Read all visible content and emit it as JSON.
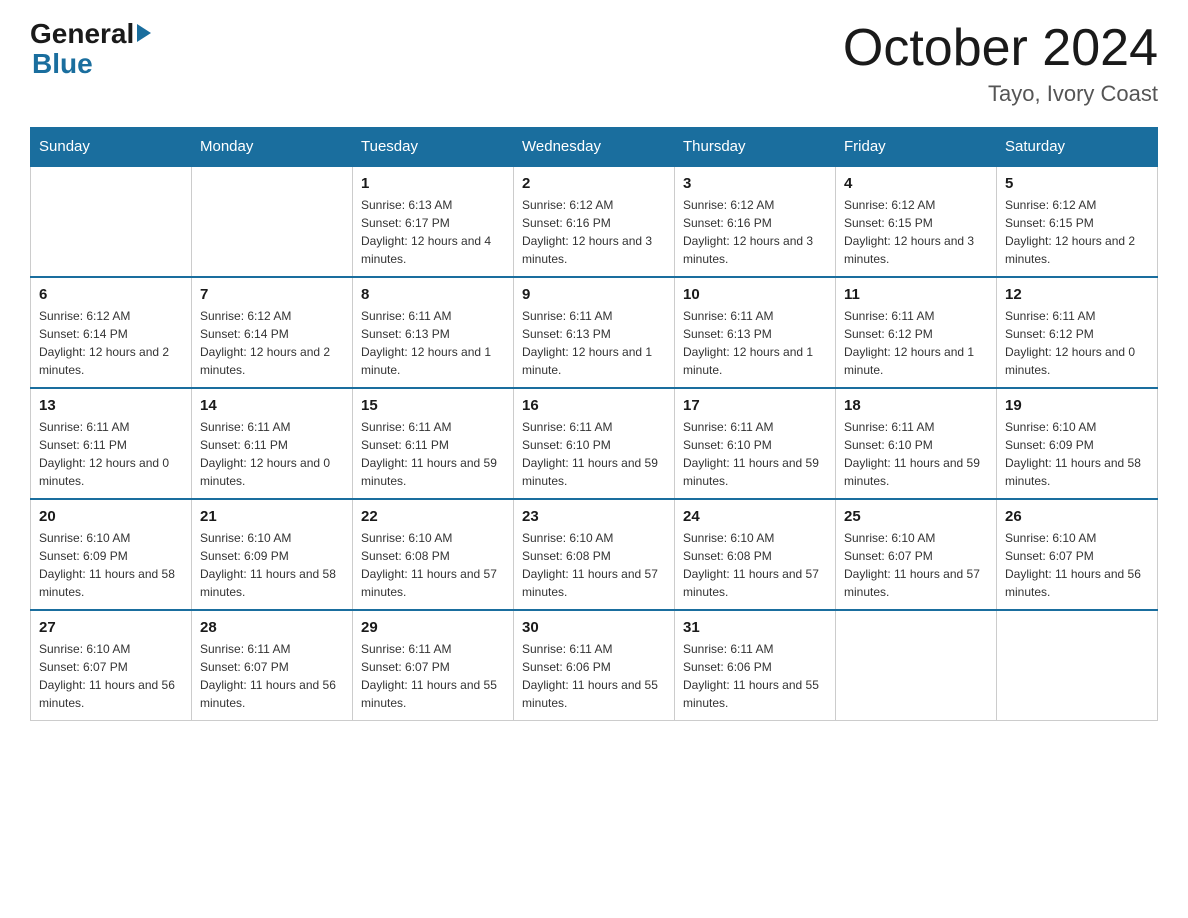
{
  "header": {
    "logo_general": "General",
    "logo_blue": "Blue",
    "title": "October 2024",
    "location": "Tayo, Ivory Coast"
  },
  "days_of_week": [
    "Sunday",
    "Monday",
    "Tuesday",
    "Wednesday",
    "Thursday",
    "Friday",
    "Saturday"
  ],
  "weeks": [
    [
      {
        "day": "",
        "info": ""
      },
      {
        "day": "",
        "info": ""
      },
      {
        "day": "1",
        "sunrise": "6:13 AM",
        "sunset": "6:17 PM",
        "daylight": "12 hours and 4 minutes."
      },
      {
        "day": "2",
        "sunrise": "6:12 AM",
        "sunset": "6:16 PM",
        "daylight": "12 hours and 3 minutes."
      },
      {
        "day": "3",
        "sunrise": "6:12 AM",
        "sunset": "6:16 PM",
        "daylight": "12 hours and 3 minutes."
      },
      {
        "day": "4",
        "sunrise": "6:12 AM",
        "sunset": "6:15 PM",
        "daylight": "12 hours and 3 minutes."
      },
      {
        "day": "5",
        "sunrise": "6:12 AM",
        "sunset": "6:15 PM",
        "daylight": "12 hours and 2 minutes."
      }
    ],
    [
      {
        "day": "6",
        "sunrise": "6:12 AM",
        "sunset": "6:14 PM",
        "daylight": "12 hours and 2 minutes."
      },
      {
        "day": "7",
        "sunrise": "6:12 AM",
        "sunset": "6:14 PM",
        "daylight": "12 hours and 2 minutes."
      },
      {
        "day": "8",
        "sunrise": "6:11 AM",
        "sunset": "6:13 PM",
        "daylight": "12 hours and 1 minute."
      },
      {
        "day": "9",
        "sunrise": "6:11 AM",
        "sunset": "6:13 PM",
        "daylight": "12 hours and 1 minute."
      },
      {
        "day": "10",
        "sunrise": "6:11 AM",
        "sunset": "6:13 PM",
        "daylight": "12 hours and 1 minute."
      },
      {
        "day": "11",
        "sunrise": "6:11 AM",
        "sunset": "6:12 PM",
        "daylight": "12 hours and 1 minute."
      },
      {
        "day": "12",
        "sunrise": "6:11 AM",
        "sunset": "6:12 PM",
        "daylight": "12 hours and 0 minutes."
      }
    ],
    [
      {
        "day": "13",
        "sunrise": "6:11 AM",
        "sunset": "6:11 PM",
        "daylight": "12 hours and 0 minutes."
      },
      {
        "day": "14",
        "sunrise": "6:11 AM",
        "sunset": "6:11 PM",
        "daylight": "12 hours and 0 minutes."
      },
      {
        "day": "15",
        "sunrise": "6:11 AM",
        "sunset": "6:11 PM",
        "daylight": "11 hours and 59 minutes."
      },
      {
        "day": "16",
        "sunrise": "6:11 AM",
        "sunset": "6:10 PM",
        "daylight": "11 hours and 59 minutes."
      },
      {
        "day": "17",
        "sunrise": "6:11 AM",
        "sunset": "6:10 PM",
        "daylight": "11 hours and 59 minutes."
      },
      {
        "day": "18",
        "sunrise": "6:11 AM",
        "sunset": "6:10 PM",
        "daylight": "11 hours and 59 minutes."
      },
      {
        "day": "19",
        "sunrise": "6:10 AM",
        "sunset": "6:09 PM",
        "daylight": "11 hours and 58 minutes."
      }
    ],
    [
      {
        "day": "20",
        "sunrise": "6:10 AM",
        "sunset": "6:09 PM",
        "daylight": "11 hours and 58 minutes."
      },
      {
        "day": "21",
        "sunrise": "6:10 AM",
        "sunset": "6:09 PM",
        "daylight": "11 hours and 58 minutes."
      },
      {
        "day": "22",
        "sunrise": "6:10 AM",
        "sunset": "6:08 PM",
        "daylight": "11 hours and 57 minutes."
      },
      {
        "day": "23",
        "sunrise": "6:10 AM",
        "sunset": "6:08 PM",
        "daylight": "11 hours and 57 minutes."
      },
      {
        "day": "24",
        "sunrise": "6:10 AM",
        "sunset": "6:08 PM",
        "daylight": "11 hours and 57 minutes."
      },
      {
        "day": "25",
        "sunrise": "6:10 AM",
        "sunset": "6:07 PM",
        "daylight": "11 hours and 57 minutes."
      },
      {
        "day": "26",
        "sunrise": "6:10 AM",
        "sunset": "6:07 PM",
        "daylight": "11 hours and 56 minutes."
      }
    ],
    [
      {
        "day": "27",
        "sunrise": "6:10 AM",
        "sunset": "6:07 PM",
        "daylight": "11 hours and 56 minutes."
      },
      {
        "day": "28",
        "sunrise": "6:11 AM",
        "sunset": "6:07 PM",
        "daylight": "11 hours and 56 minutes."
      },
      {
        "day": "29",
        "sunrise": "6:11 AM",
        "sunset": "6:07 PM",
        "daylight": "11 hours and 55 minutes."
      },
      {
        "day": "30",
        "sunrise": "6:11 AM",
        "sunset": "6:06 PM",
        "daylight": "11 hours and 55 minutes."
      },
      {
        "day": "31",
        "sunrise": "6:11 AM",
        "sunset": "6:06 PM",
        "daylight": "11 hours and 55 minutes."
      },
      {
        "day": "",
        "info": ""
      },
      {
        "day": "",
        "info": ""
      }
    ]
  ],
  "labels": {
    "sunrise_prefix": "Sunrise: ",
    "sunset_prefix": "Sunset: ",
    "daylight_prefix": "Daylight: "
  }
}
